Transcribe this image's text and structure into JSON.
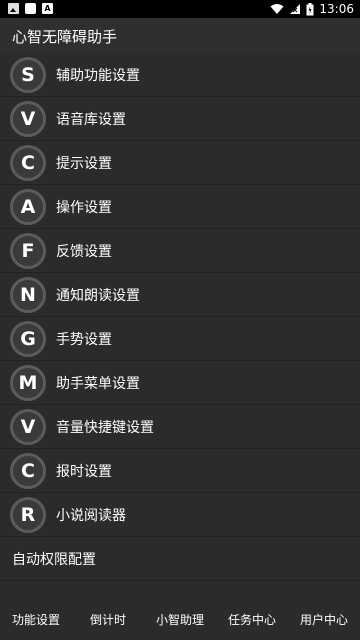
{
  "status_bar": {
    "left_icons": [
      "image-icon",
      "bag-icon",
      "a-icon"
    ],
    "right_icons": [
      "wifi-icon",
      "signal-icon",
      "battery-icon"
    ],
    "time": "13:06"
  },
  "app_bar": {
    "title": "心智无障碍助手"
  },
  "menu": {
    "items": [
      {
        "letter": "S",
        "label": "辅助功能设置"
      },
      {
        "letter": "V",
        "label": "语音库设置"
      },
      {
        "letter": "C",
        "label": "提示设置"
      },
      {
        "letter": "A",
        "label": "操作设置"
      },
      {
        "letter": "F",
        "label": "反馈设置"
      },
      {
        "letter": "N",
        "label": "通知朗读设置"
      },
      {
        "letter": "G",
        "label": "手势设置"
      },
      {
        "letter": "M",
        "label": "助手菜单设置"
      },
      {
        "letter": "V",
        "label": "音量快捷键设置"
      },
      {
        "letter": "C",
        "label": "报时设置"
      },
      {
        "letter": "R",
        "label": "小说阅读器"
      }
    ],
    "plain_item": "自动权限配置"
  },
  "bottom_nav": {
    "tabs": [
      "功能设置",
      "倒计时",
      "小智助理",
      "任务中心",
      "用户中心"
    ]
  },
  "colors": {
    "background": "#2b2b2b",
    "status_bar": "#000000",
    "badge_ring": "#5c5c5c"
  }
}
